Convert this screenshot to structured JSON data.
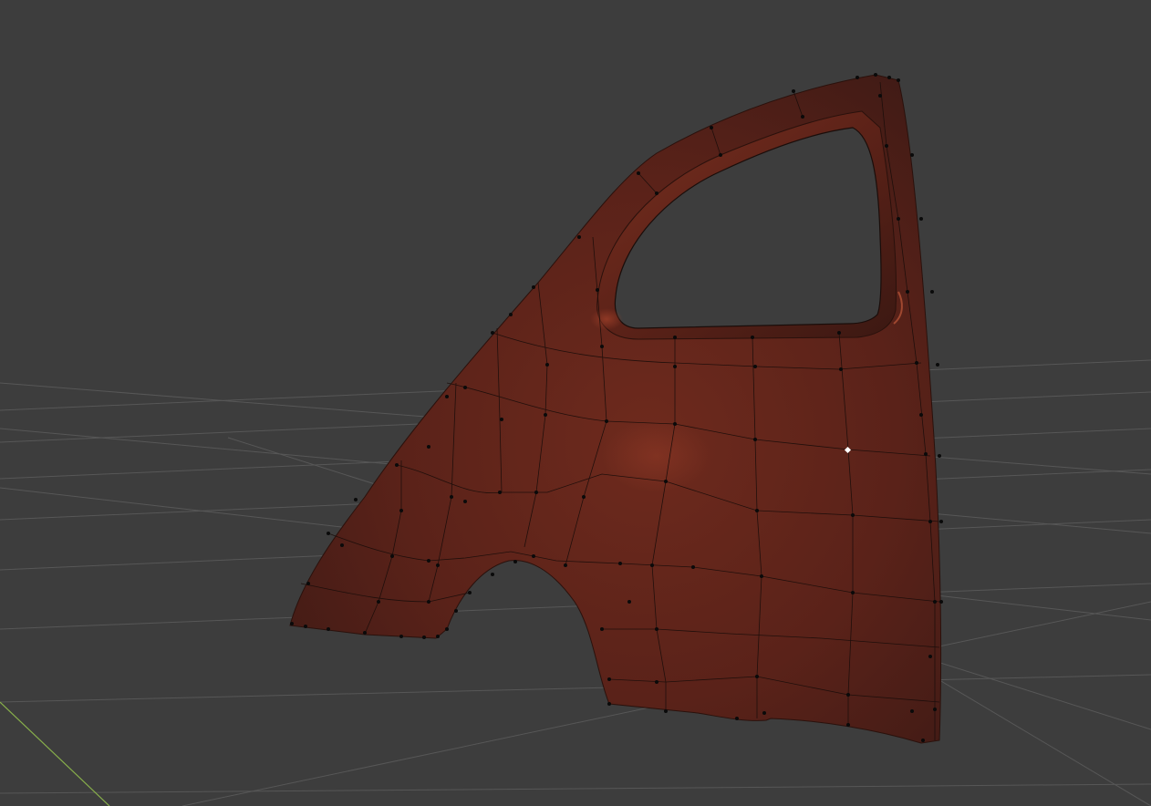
{
  "viewport": {
    "mode": "3d-viewport",
    "shading": "solid",
    "background_color": "#3d3d3d",
    "grid_color": "#575757",
    "x_axis_color": "#88b04b",
    "object": {
      "name_visible": false,
      "type": "mesh",
      "description_icon": "car-rear-door-panel-icon",
      "material_color": "#6b2a1c",
      "highlight_color": "#b4482c",
      "wire_color": "#1a0d0a",
      "vertex_color": "#0a0a0a",
      "active_vertex_color": "#ffffff",
      "selected_vertex_count_visible": false
    }
  }
}
